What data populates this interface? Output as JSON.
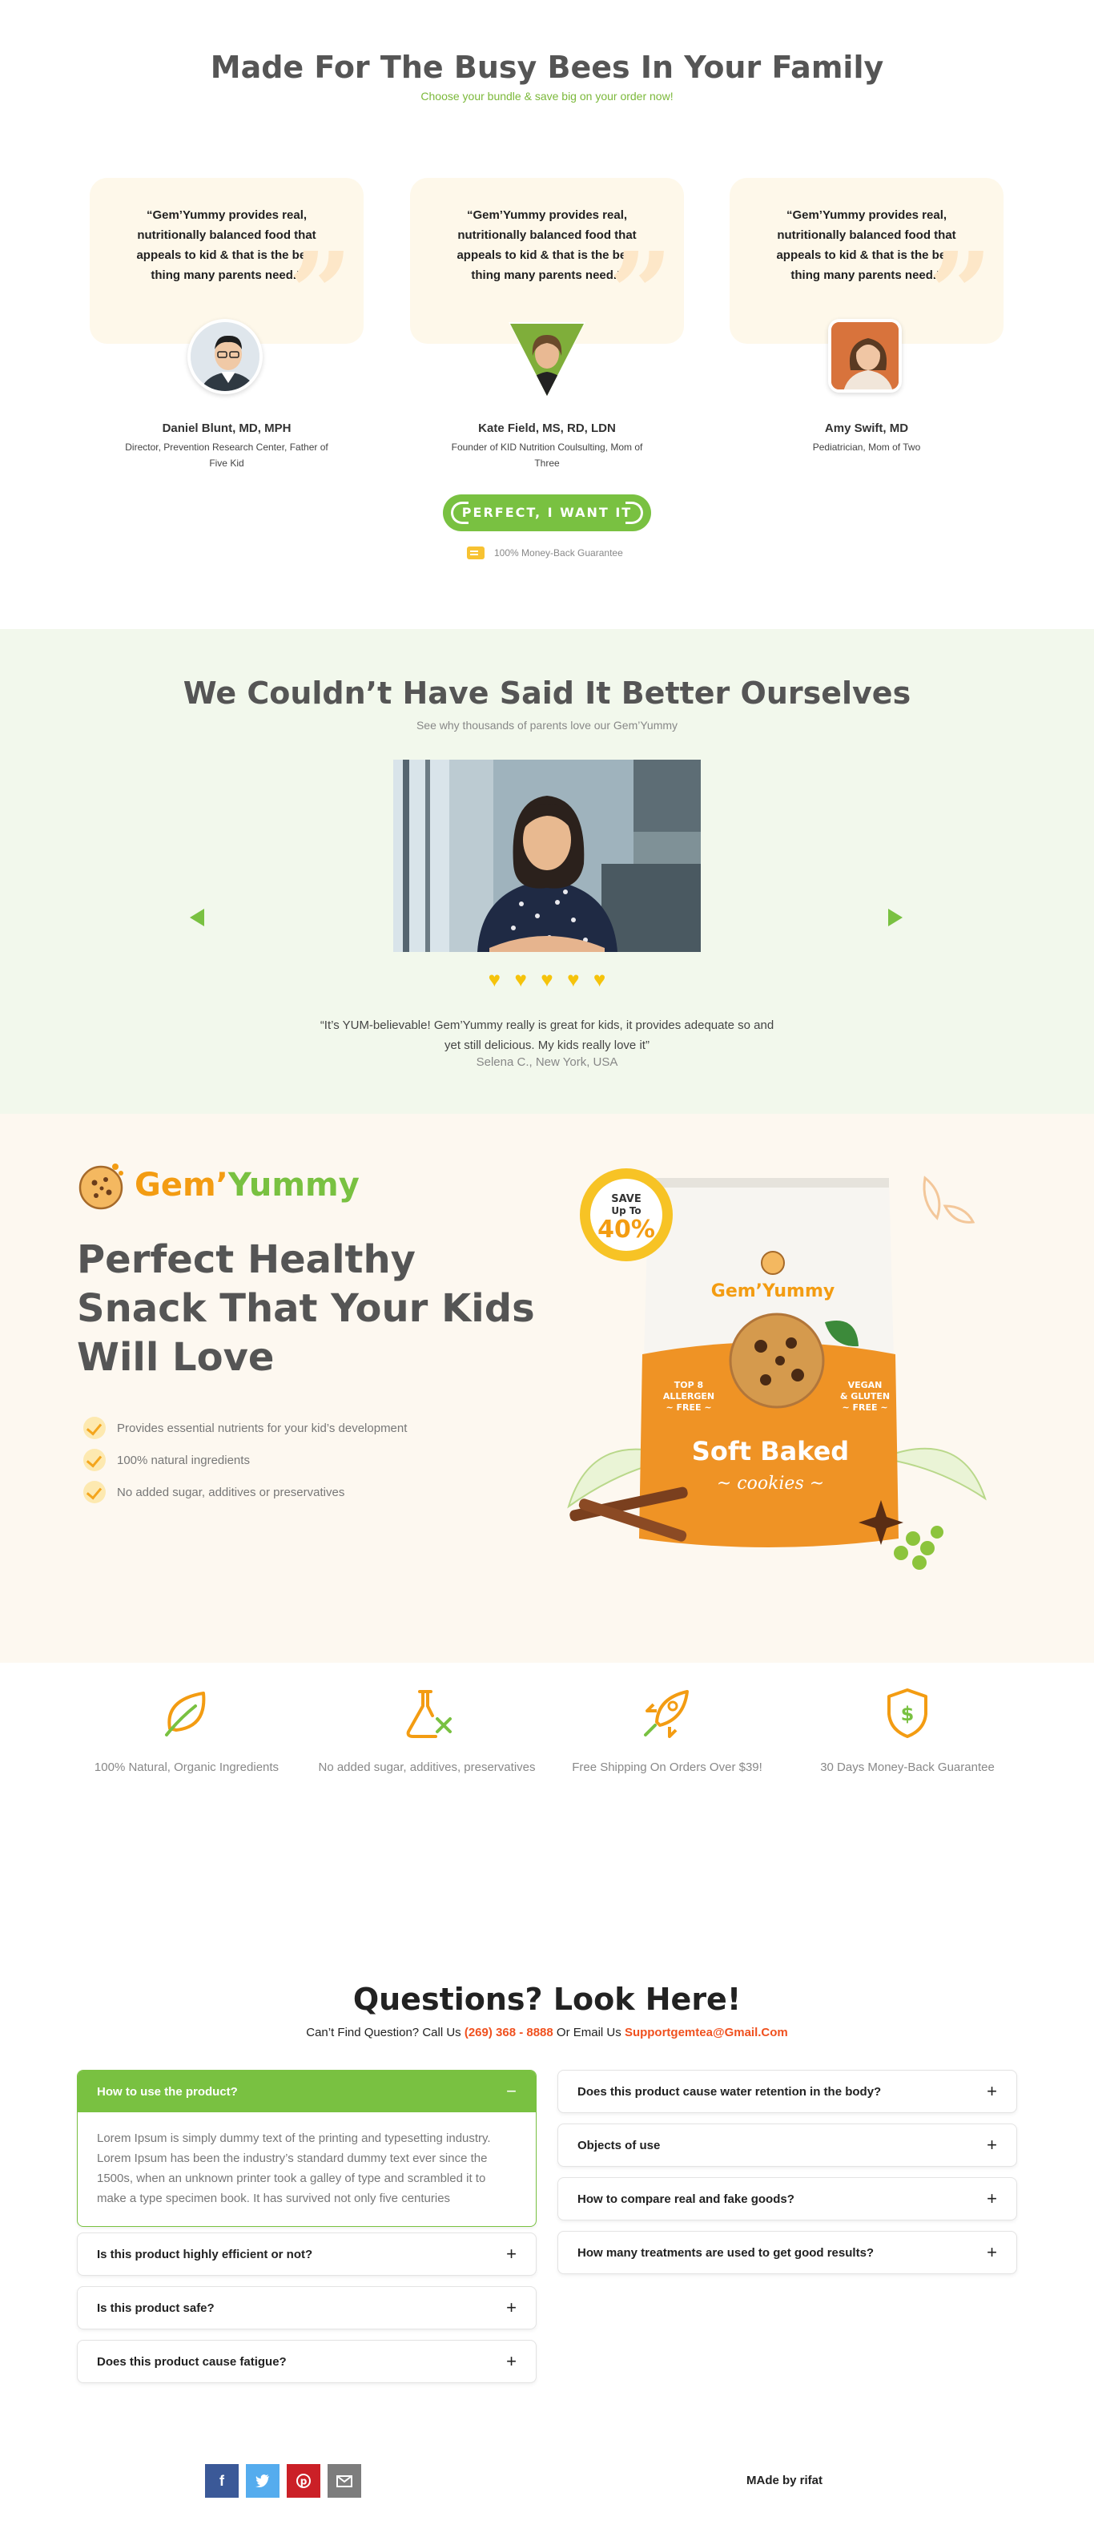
{
  "testimonials": {
    "title": "Made For The Busy Bees In Your Family",
    "subtitle": "Choose your bundle & save big on your order now!",
    "items": [
      {
        "quote": "“Gem’Yummy provides real, nutritionally balanced food that appeals to kid & that is the best thing many parents need.”",
        "name": "Daniel Blunt, MD, MPH",
        "role": "Director, Prevention Research Center, Father of Five Kid"
      },
      {
        "quote": "“Gem’Yummy provides real, nutritionally balanced food that appeals to kid & that is the best thing many parents need.”",
        "name": "Kate Field, MS, RD, LDN",
        "role": "Founder of KID Nutrition Coulsulting, Mom of Three"
      },
      {
        "quote": "“Gem’Yummy provides real, nutritionally balanced food that appeals to kid & that is the best thing many parents need.”",
        "name": "Amy Swift, MD",
        "role": "Pediatrician, Mom of Two"
      }
    ],
    "cta_label": "PERFECT, I WANT IT",
    "guarantee": "100% Money-Back Guarantee"
  },
  "reviews": {
    "title": "We Couldn’t Have Said It Better Ourselves",
    "subtitle": "See why thousands of parents love our Gem’Yummy",
    "rating": 5,
    "quote": "“It’s YUM-believable! Gem’Yummy really is great for kids, it provides adequate so and yet still delicious. My kids really love it”",
    "reviewer": "Selena C., New York, USA"
  },
  "hero": {
    "brand_a": "Gem",
    "brand_mark": "’",
    "brand_b": "Yummy",
    "title": "Perfect Healthy Snack That Your Kids Will Love",
    "features": [
      "Provides essential nutrients for your kid’s development",
      "100% natural ingredients",
      "No added sugar, additives or preservatives"
    ],
    "badge_save": "SAVE",
    "badge_upto": "Up To",
    "badge_pct": "40%",
    "bag_brand": "Gem’Yummy",
    "bag_left_1": "TOP 8",
    "bag_left_2": "ALLERGEN",
    "bag_left_3": "~ FREE ~",
    "bag_right_1": "VEGAN",
    "bag_right_2": "& GLUTEN",
    "bag_right_3": "~ FREE ~",
    "bag_title": "Soft Baked",
    "bag_sub": "~ cookies ~"
  },
  "features": [
    {
      "label": "100% Natural, Organic Ingredients",
      "icon": "leaf-icon"
    },
    {
      "label": "No added sugar, additives, preservatives",
      "icon": "flask-icon"
    },
    {
      "label": "Free Shipping On Orders Over $39!",
      "icon": "rocket-icon"
    },
    {
      "label": "30 Days Money-Back Guarantee",
      "icon": "shield-dollar-icon"
    }
  ],
  "faq": {
    "title": "Questions? Look Here!",
    "sub_pre": "Can’t Find Question? Call Us",
    "phone": "(269) 368 - 8888",
    "sub_mid": "Or Email Us",
    "email": "Supportgemtea@Gmail.Com",
    "open_q": "How to use the product?",
    "open_a": "Lorem Ipsum is simply dummy text of the printing and typesetting industry. Lorem Ipsum has been the industry’s standard dummy text ever since the 1500s, when an unknown printer took a galley of type and scrambled it to make a type specimen book. It has survived not only five centuries",
    "left": [
      "Is this product highly efficient or not?",
      "Is this product safe?",
      "Does this product cause fatigue?"
    ],
    "right": [
      "Does this product cause water retention in the body?",
      "Objects of use",
      "How to compare real and fake goods?",
      "How many treatments are used to get good results?"
    ],
    "minus": "−",
    "plus": "+"
  },
  "footer": {
    "social": [
      "facebook",
      "twitter",
      "pinterest",
      "email"
    ],
    "made_by": "MAde by rifat"
  },
  "colors": {
    "accent_green": "#79c141",
    "accent_orange": "#f39c12",
    "highlight": "#f0511f",
    "star": "#f5c30b"
  }
}
